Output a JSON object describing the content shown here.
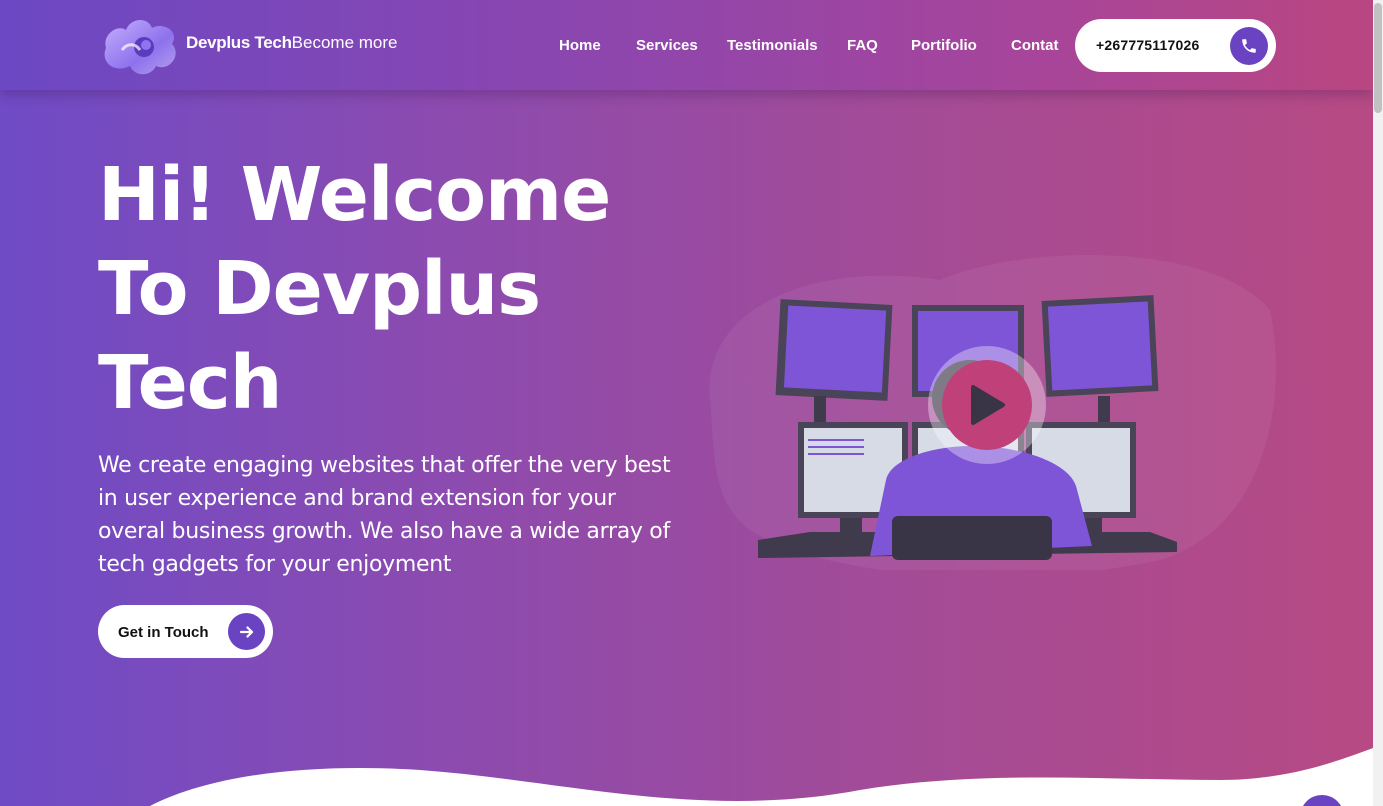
{
  "header": {
    "brand_name": "Devplus Tech",
    "brand_tagline": "Become more",
    "logo_icon": "blob-logo-icon"
  },
  "nav": {
    "items": [
      {
        "label": "Home"
      },
      {
        "label": "Services"
      },
      {
        "label": "Testimonials"
      },
      {
        "label": "FAQ"
      },
      {
        "label": "Portifolio"
      },
      {
        "label": "Contat"
      }
    ]
  },
  "phone": {
    "number": "+267775117026",
    "icon": "phone-icon"
  },
  "hero": {
    "title_line1": "Hi! Welcome",
    "title_line2": "To Devplus",
    "title_line3": "Tech",
    "description": "We create engaging websites that offer the very best in user experience and brand extension for your overal business growth. We also have a wide array of tech gadgets for your enjoyment",
    "cta_label": "Get in Touch",
    "cta_icon": "arrow-right-icon",
    "play_icon": "play-icon"
  },
  "colors": {
    "accent": "#6a43c2",
    "play": "#c0417a",
    "gradient_start": "#6f4bc6",
    "gradient_end": "#b74a84"
  }
}
